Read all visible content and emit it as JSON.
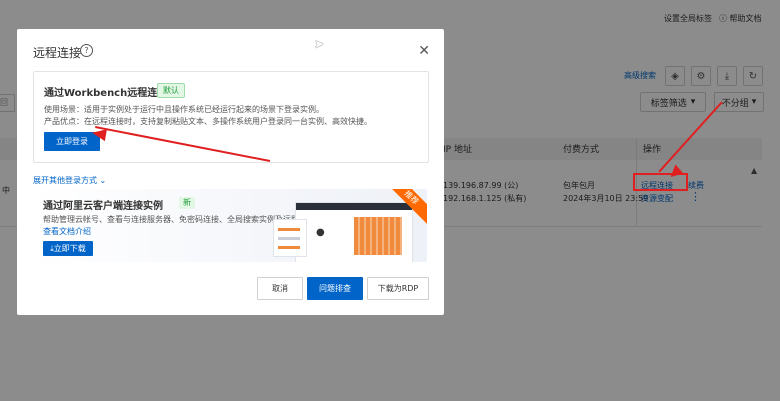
{
  "top_links": {
    "global_tags": "设置全局标签",
    "help_doc": "帮助文档"
  },
  "toolbar": {
    "advanced_search": "高级搜索",
    "tag_filter": "标签筛选",
    "group": "不分组"
  },
  "table": {
    "headers": {
      "ip": "IP 地址",
      "billing": "付费方式",
      "actions": "操作"
    },
    "row": {
      "status_partial": "中",
      "public_ip": "139.196.87.99 (公)",
      "private_ip": "192.168.1.125 (私有)",
      "billing_type": "包年包月",
      "expire": "2024年3月10日 23:59",
      "action_remote": "远程连接",
      "action_renew": "续费",
      "action_resource": "资源变配"
    }
  },
  "left_partial": "回",
  "modal": {
    "title": "远程连接",
    "workbench": {
      "title": "通过Workbench远程连接",
      "badge": "默认",
      "scenario": "使用场景：适用于实例处于运行中且操作系统已经运行起来的场景下登录实例。",
      "advantage": "产品优点：在远程连接时，支持复制粘贴文本、多操作系统用户登录同一台实例、高效快捷。",
      "login_button": "立即登录"
    },
    "expand_other": "展开其他登录方式",
    "client": {
      "title": "通过阿里云客户端连接实例",
      "new_tag": "新",
      "desc": "帮助管理云帐号、查看与连接服务器、免密码连接、全局搜索实例及远程连接。",
      "doc_link": "查看文档介绍",
      "download": "立即下载",
      "ribbon": "推荐"
    },
    "footer": {
      "cancel": "取消",
      "troubleshoot": "问题排查",
      "download_rdp": "下载为RDP"
    }
  },
  "colors": {
    "primary": "#0064c8",
    "annotation": "#e02020",
    "ribbon": "#ff6a00"
  }
}
